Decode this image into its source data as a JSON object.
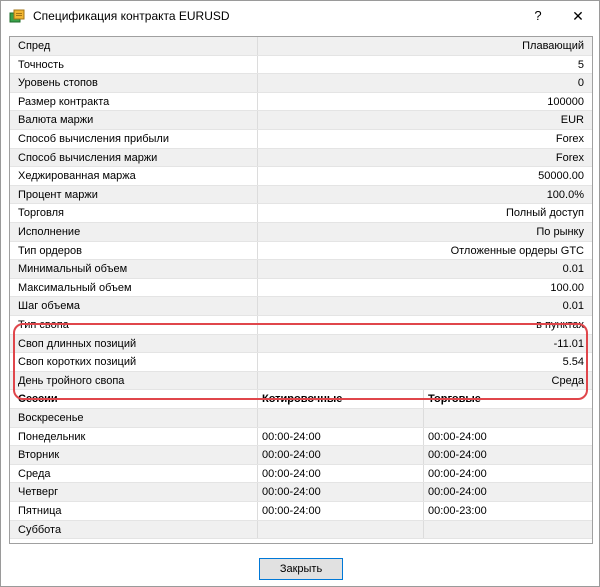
{
  "window": {
    "title": "Спецификация контракта EURUSD",
    "help_label": "?",
    "close_label": "✕"
  },
  "specs": [
    {
      "key": "Спред",
      "value": "Плавающий"
    },
    {
      "key": "Точность",
      "value": "5"
    },
    {
      "key": "Уровень стопов",
      "value": "0"
    },
    {
      "key": "Размер контракта",
      "value": "100000"
    },
    {
      "key": "Валюта маржи",
      "value": "EUR"
    },
    {
      "key": "Способ вычисления прибыли",
      "value": "Forex"
    },
    {
      "key": "Способ вычисления маржи",
      "value": "Forex"
    },
    {
      "key": "Хеджированная маржа",
      "value": "50000.00"
    },
    {
      "key": "Процент маржи",
      "value": "100.0%"
    },
    {
      "key": "Торговля",
      "value": "Полный доступ"
    },
    {
      "key": "Исполнение",
      "value": "По рынку"
    },
    {
      "key": "Тип ордеров",
      "value": "Отложенные ордеры GTC"
    },
    {
      "key": "Минимальный объем",
      "value": "0.01"
    },
    {
      "key": "Максимальный объем",
      "value": "100.00"
    },
    {
      "key": "Шаг объема",
      "value": "0.01"
    },
    {
      "key": "Тип свопа",
      "value": "в пунктах"
    },
    {
      "key": "Своп длинных позиций",
      "value": "-11.01"
    },
    {
      "key": "Своп коротких позиций",
      "value": "5.54"
    },
    {
      "key": "День тройного свопа",
      "value": "Среда"
    }
  ],
  "sessions": {
    "headers": [
      "Сессии",
      "Котировочные",
      "Торговые"
    ],
    "rows": [
      [
        "Воскресенье",
        "",
        ""
      ],
      [
        "Понедельник",
        "00:00-24:00",
        "00:00-24:00"
      ],
      [
        "Вторник",
        "00:00-24:00",
        "00:00-24:00"
      ],
      [
        "Среда",
        "00:00-24:00",
        "00:00-24:00"
      ],
      [
        "Четверг",
        "00:00-24:00",
        "00:00-24:00"
      ],
      [
        "Пятница",
        "00:00-24:00",
        "00:00-23:00"
      ],
      [
        "Суббота",
        "",
        ""
      ]
    ]
  },
  "footer": {
    "close_button": "Закрыть"
  },
  "colors": {
    "highlight": "#e0464b",
    "alt_row": "#f0f0f0",
    "button_border": "#0078d7"
  }
}
